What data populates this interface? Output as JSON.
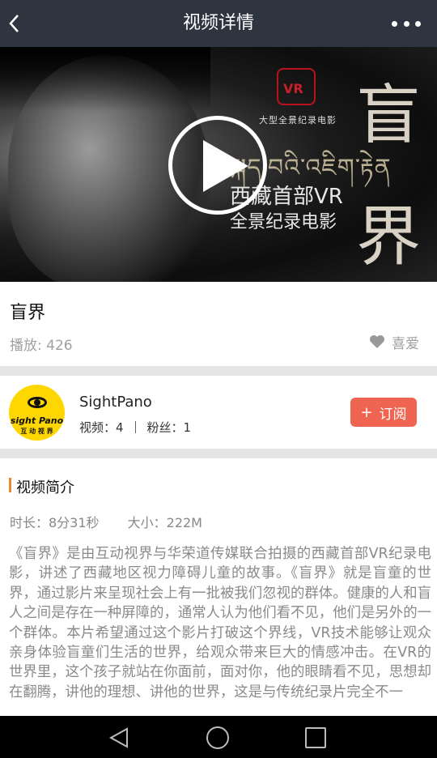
{
  "header": {
    "title": "视频详情"
  },
  "video": {
    "poster_cn_line1": "西藏首部VR",
    "poster_cn_line2": "全景纪录电影",
    "poster_caption": "大型全景纪录电影",
    "poster_seal": "VR",
    "poster_tibetan": "སྐད་བའི་འཇིག་རྟེན",
    "poster_calligraphy": "盲界"
  },
  "info": {
    "title": "盲界",
    "plays_label": "播放: 426",
    "like_label": "喜爱"
  },
  "channel": {
    "name": "SightPano",
    "avatar_brand": "sight Pano",
    "avatar_brand_cn": "互 动 视 界",
    "videos_label": "视频：4",
    "fans_label": "粉丝：1",
    "subscribe_label": "订阅",
    "subscribe_plus": "+"
  },
  "description": {
    "heading": "视频简介",
    "duration": "时长：8分31秒",
    "size": "大小：222M",
    "text": "《盲界》是由互动视界与华荣道传媒联合拍摄的西藏首部VR纪录电影，讲述了西藏地区视力障碍儿童的故事。《盲界》就是盲童的世界，通过影片来呈现社会上有一批被我们忽视的群体。健康的人和盲人之间是存在一种屏障的，通常人认为他们看不见，他们是另外的一个群体。本片希望通过这个影片打破这个界线，VR技术能够让观众亲身体验盲童们生活的世界，给观众带来巨大的情感冲击。在VR的世界里，这个孩子就站在你面前，面对你，他的眼睛看不见，思想却在翻腾，讲他的理想、讲他的世界，这是与传统纪录片完全不一"
  },
  "colors": {
    "topbar": "#2f3441",
    "subscribe": "#f06552",
    "accent": "#f0862d",
    "avatar": "#ffd700"
  }
}
